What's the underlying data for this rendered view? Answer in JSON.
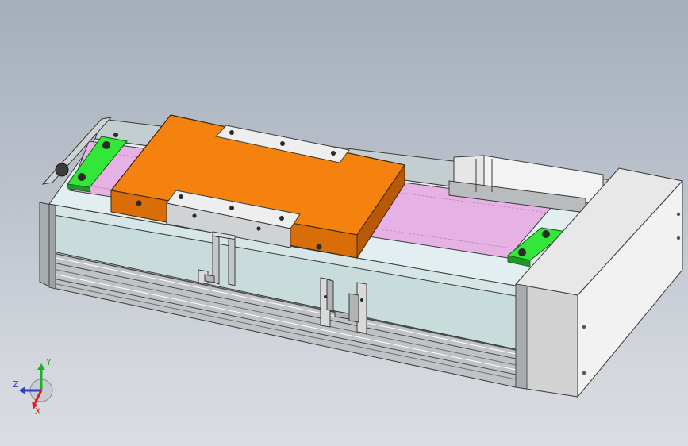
{
  "viewport": {
    "background_top": "#a5aebb",
    "background_bottom": "#dadde2"
  },
  "model": {
    "parts": [
      "base-extrusion",
      "motor-end-cap",
      "servo-motor",
      "carriage-plate",
      "belt-cover",
      "end-clamp-plate",
      "limit-sensor-bracket",
      "belt-clamp"
    ],
    "colors": {
      "carriage": "#f5810f",
      "belt_cover": "#e6b1e4",
      "clamp": "#33e63a",
      "extrusion": "#b8bcbf",
      "end_cap": "#dedede",
      "side_panel": "#cde0e0"
    }
  },
  "triad": {
    "x_label": "X",
    "y_label": "Y",
    "z_label": "Z",
    "x_color": "#d81f1f",
    "y_color": "#1fae2a",
    "z_color": "#2b3fcf",
    "icon": "coordinate-triad-icon"
  }
}
